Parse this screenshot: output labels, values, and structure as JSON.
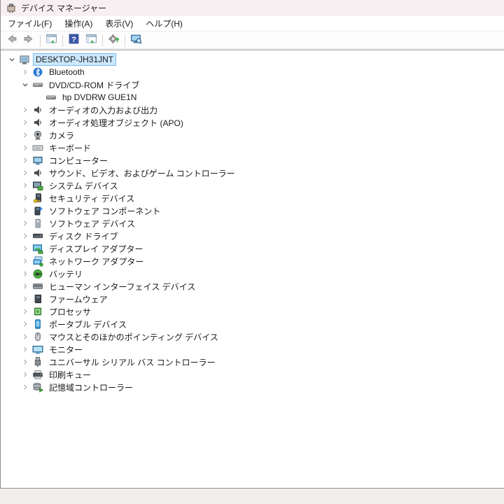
{
  "window": {
    "title": "デバイス マネージャー"
  },
  "menu": {
    "items": [
      {
        "id": "file",
        "label": "ファイル(F)"
      },
      {
        "id": "action",
        "label": "操作(A)"
      },
      {
        "id": "view",
        "label": "表示(V)"
      },
      {
        "id": "help",
        "label": "ヘルプ(H)"
      }
    ]
  },
  "toolbar": {
    "items": [
      {
        "type": "button",
        "id": "back",
        "icon": "arrow-left"
      },
      {
        "type": "button",
        "id": "forward",
        "icon": "arrow-right"
      },
      {
        "type": "separator"
      },
      {
        "type": "button",
        "id": "show-hide-console-tree",
        "icon": "console-tree"
      },
      {
        "type": "separator"
      },
      {
        "type": "button",
        "id": "help",
        "icon": "help"
      },
      {
        "type": "button",
        "id": "show-hide-action-pane",
        "icon": "action-pane"
      },
      {
        "type": "separator"
      },
      {
        "type": "button",
        "id": "scan-for-hardware-changes",
        "icon": "scan-hardware"
      },
      {
        "type": "separator"
      },
      {
        "type": "button",
        "id": "computer-properties",
        "icon": "computer-search"
      }
    ]
  },
  "tree": {
    "items": [
      {
        "label": "DESKTOP-JH31JNT",
        "level": 0,
        "state": "expanded",
        "icon": "computer",
        "selected": true
      },
      {
        "label": "Bluetooth",
        "level": 1,
        "state": "collapsed",
        "icon": "bluetooth"
      },
      {
        "label": "DVD/CD-ROM ドライブ",
        "level": 1,
        "state": "expanded",
        "icon": "disc-drive"
      },
      {
        "label": "hp DVDRW GUE1N",
        "level": 2,
        "state": "leaf",
        "icon": "disc-drive"
      },
      {
        "label": "オーディオの入力および出力",
        "level": 1,
        "state": "collapsed",
        "icon": "audio"
      },
      {
        "label": "オーディオ処理オブジェクト (APO)",
        "level": 1,
        "state": "collapsed",
        "icon": "audio"
      },
      {
        "label": "カメラ",
        "level": 1,
        "state": "collapsed",
        "icon": "camera"
      },
      {
        "label": "キーボード",
        "level": 1,
        "state": "collapsed",
        "icon": "keyboard"
      },
      {
        "label": "コンピューター",
        "level": 1,
        "state": "collapsed",
        "icon": "monitor"
      },
      {
        "label": "サウンド、ビデオ、およびゲーム コントローラー",
        "level": 1,
        "state": "collapsed",
        "icon": "audio"
      },
      {
        "label": "システム デバイス",
        "level": 1,
        "state": "collapsed",
        "icon": "system-device"
      },
      {
        "label": "セキュリティ デバイス",
        "level": 1,
        "state": "collapsed",
        "icon": "security-device"
      },
      {
        "label": "ソフトウェア コンポーネント",
        "level": 1,
        "state": "collapsed",
        "icon": "software-component"
      },
      {
        "label": "ソフトウェア デバイス",
        "level": 1,
        "state": "collapsed",
        "icon": "software-device"
      },
      {
        "label": "ディスク ドライブ",
        "level": 1,
        "state": "collapsed",
        "icon": "disk-drive"
      },
      {
        "label": "ディスプレイ アダプター",
        "level": 1,
        "state": "collapsed",
        "icon": "display-adapter"
      },
      {
        "label": "ネットワーク アダプター",
        "level": 1,
        "state": "collapsed",
        "icon": "network-adapter"
      },
      {
        "label": "バッテリ",
        "level": 1,
        "state": "collapsed",
        "icon": "battery"
      },
      {
        "label": "ヒューマン インターフェイス デバイス",
        "level": 1,
        "state": "collapsed",
        "icon": "hid"
      },
      {
        "label": "ファームウェア",
        "level": 1,
        "state": "collapsed",
        "icon": "firmware"
      },
      {
        "label": "プロセッサ",
        "level": 1,
        "state": "collapsed",
        "icon": "processor"
      },
      {
        "label": "ポータブル デバイス",
        "level": 1,
        "state": "collapsed",
        "icon": "portable-device"
      },
      {
        "label": "マウスとそのほかのポインティング デバイス",
        "level": 1,
        "state": "collapsed",
        "icon": "mouse"
      },
      {
        "label": "モニター",
        "level": 1,
        "state": "collapsed",
        "icon": "monitor-display"
      },
      {
        "label": "ユニバーサル シリアル バス コントローラー",
        "level": 1,
        "state": "collapsed",
        "icon": "usb"
      },
      {
        "label": "印刷キュー",
        "level": 1,
        "state": "collapsed",
        "icon": "printer"
      },
      {
        "label": "記憶域コントローラー",
        "level": 1,
        "state": "collapsed",
        "icon": "storage-controller"
      }
    ]
  },
  "colors": {
    "titlebar_bg": "#f7f0f2",
    "selection_bg": "#cce8ff",
    "selection_border": "#77bdf0",
    "chevron_collapsed": "#a6a6a6",
    "chevron_expanded": "#3f3f3f"
  }
}
